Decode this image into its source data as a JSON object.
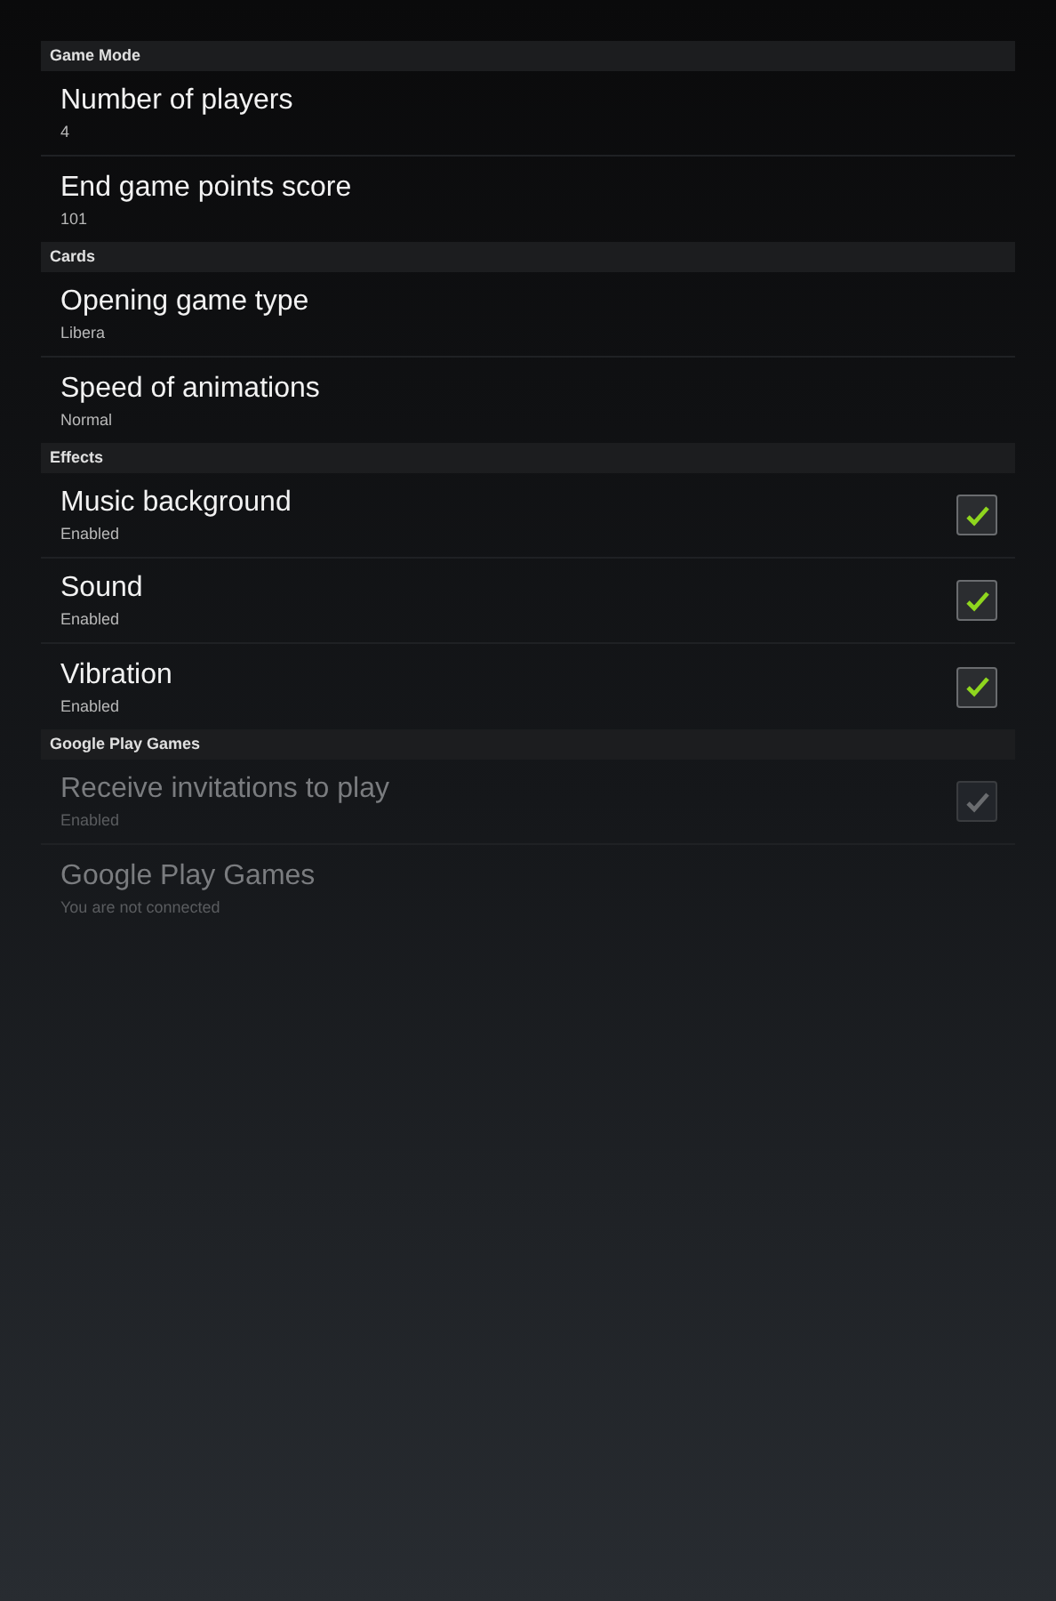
{
  "sections": [
    {
      "title": "Game Mode",
      "items": [
        {
          "kind": "text",
          "title": "Number of players",
          "summary": "4",
          "disabled": false
        },
        {
          "kind": "text",
          "title": "End game points score",
          "summary": "101",
          "disabled": false
        }
      ]
    },
    {
      "title": "Cards",
      "items": [
        {
          "kind": "text",
          "title": "Opening game type",
          "summary": "Libera",
          "disabled": false
        },
        {
          "kind": "text",
          "title": "Speed of animations",
          "summary": "Normal",
          "disabled": false
        }
      ]
    },
    {
      "title": "Effects",
      "items": [
        {
          "kind": "checkbox",
          "title": "Music background",
          "summary": "Enabled",
          "checked": true,
          "disabled": false
        },
        {
          "kind": "checkbox",
          "title": "Sound",
          "summary": "Enabled",
          "checked": true,
          "disabled": false
        },
        {
          "kind": "checkbox",
          "title": "Vibration",
          "summary": "Enabled",
          "checked": true,
          "disabled": false
        }
      ]
    },
    {
      "title": "Google Play Games",
      "items": [
        {
          "kind": "checkbox",
          "title": "Receive invitations to play",
          "summary": "Enabled",
          "checked": true,
          "disabled": true
        },
        {
          "kind": "text",
          "title": "Google Play Games",
          "summary": "You are not connected",
          "disabled": true
        }
      ]
    }
  ]
}
